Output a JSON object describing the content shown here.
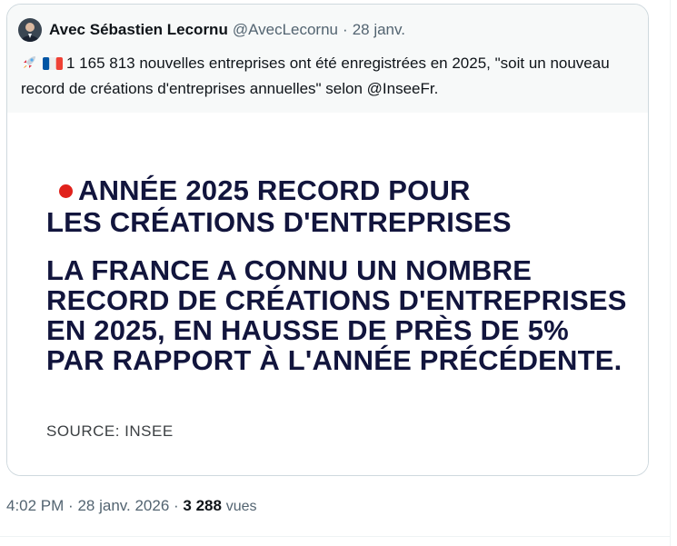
{
  "quoted_post": {
    "author_name": "Avec Sébastien Lecornu",
    "author_handle": "@AvecLecornu",
    "separator": "·",
    "date": "28 janv.",
    "text": "1 165 813 nouvelles entreprises ont été enregistrées en 2025, \"soit un nouveau record de créations d'entreprises annuelles\" selon @InseeFr.",
    "emojis": [
      "rocket-emoji",
      "french-flag-emoji"
    ]
  },
  "media": {
    "headline_line1": "ANNÉE 2025 RECORD POUR",
    "headline_line2": "LES CRÉATIONS D'ENTREPRISES",
    "body_lines": [
      "LA FRANCE A CONNU UN NOMBRE",
      "RECORD DE CRÉATIONS D'ENTREPRISES",
      "EN 2025, EN HAUSSE DE PRÈS DE 5%",
      "PAR RAPPORT À L'ANNÉE PRÉCÉDENTE."
    ],
    "source": "SOURCE: INSEE",
    "accent_color": "#e0211b",
    "text_color": "#12153d"
  },
  "meta": {
    "time": "4:02 PM",
    "separator": "·",
    "date": "28 janv. 2026",
    "views_count": "3 288",
    "views_label": "vues"
  }
}
